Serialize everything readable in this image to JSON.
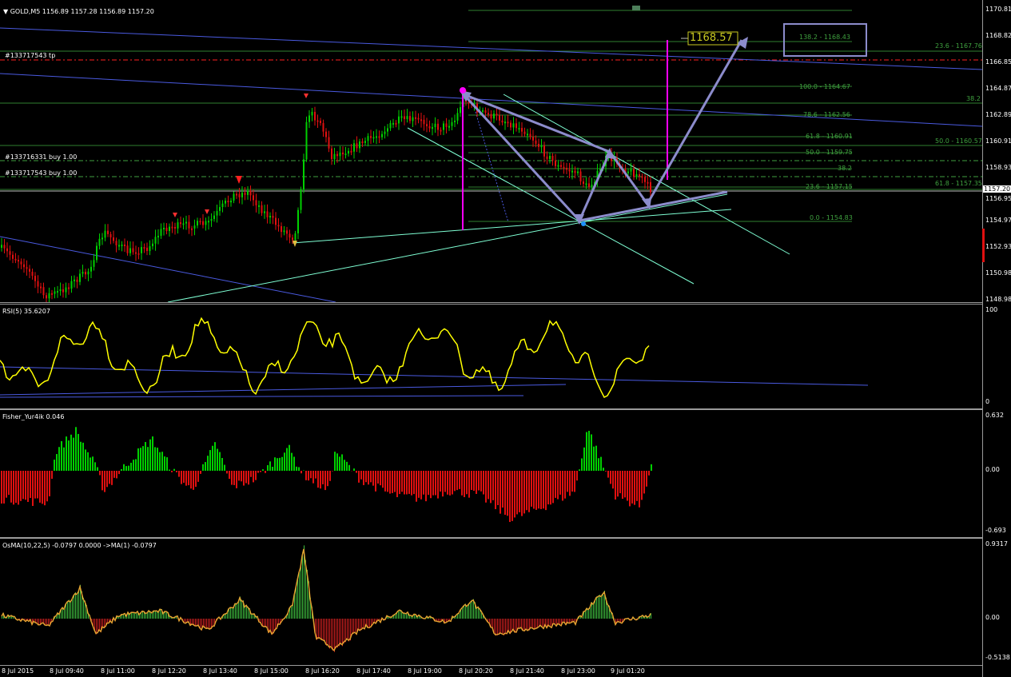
{
  "header": {
    "symbol_info": "GOLD,M5  1156.89 1157.28 1156.89 1157.20"
  },
  "orders": [
    "#133717543 tp",
    "#133716331 buy 1.00",
    "#133717543 buy 1.00"
  ],
  "price_axis": [
    "1170.81",
    "1168.82",
    "1166.85",
    "1164.87",
    "1162.89",
    "1160.91",
    "1158.93",
    "1156.95",
    "1154.97",
    "1152.93",
    "1150.98",
    "1148.98"
  ],
  "current_price": "1157.20",
  "target_label": "1168.57",
  "fib_right": [
    {
      "text": "23.6 - 1167.76"
    },
    {
      "text": "38.2"
    },
    {
      "text": "50.0 - 1160.57"
    },
    {
      "text": "61.8 - 1157.35"
    }
  ],
  "fib_mid": [
    {
      "text": "138.2 - 1168.43"
    },
    {
      "text": "100.0 - 1164.67"
    },
    {
      "text": "78.6 - 1162.56"
    },
    {
      "text": "61.8 - 1160.91"
    },
    {
      "text": "50.0 - 1159.75"
    },
    {
      "text": "38.2"
    },
    {
      "text": "23.6 - 1157.15"
    },
    {
      "text": "0.0 - 1154.83"
    }
  ],
  "rsi": {
    "title": "RSI(5) 35.6207",
    "top": "100",
    "bottom": "0"
  },
  "fisher": {
    "title": "Fisher_Yur4ik 0.046",
    "top": "0.632",
    "mid": "0.00",
    "bottom": "-0.693"
  },
  "osma": {
    "title": "OsMA(10,22,5) -0.0797 0.0000  ->MA(1) -0.0797",
    "top": "0.9317",
    "mid": "0.00",
    "bottom": "-0.5138"
  },
  "time_axis": [
    "8 Jul 2015",
    "8 Jul 09:40",
    "8 Jul 11:00",
    "8 Jul 12:20",
    "8 Jul 13:40",
    "8 Jul 15:00",
    "8 Jul 16:20",
    "8 Jul 17:40",
    "8 Jul 19:00",
    "8 Jul 20:20",
    "8 Jul 21:40",
    "8 Jul 23:00",
    "9 Jul 01:20"
  ],
  "colors": {
    "bull": "#00d000",
    "bear": "#e01010",
    "rsi": "#ffff00",
    "pattern": "#8c8ccc",
    "fib": "#3fa13f",
    "blue": "#4a5ae0",
    "cyan": "#7fffd4",
    "magenta": "#ff00ff"
  }
}
